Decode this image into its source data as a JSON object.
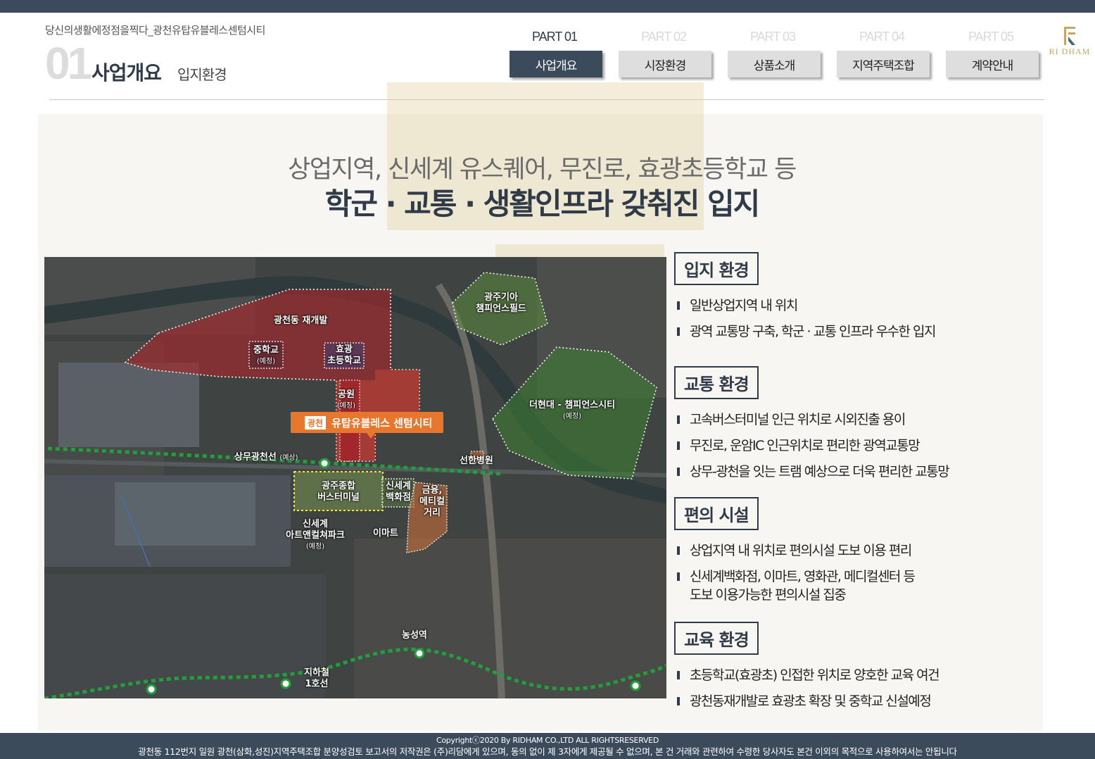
{
  "header": {
    "slogan": "당신의생활에정점을찍다_광천유탑유블레스센텀시티",
    "section_number": "01",
    "section_title": "사업개요",
    "section_subtitle": "입지환경"
  },
  "parts": [
    {
      "label": "PART 01",
      "button": "사업개요",
      "active": true
    },
    {
      "label": "PART 02",
      "button": "시장환경",
      "active": false
    },
    {
      "label": "PART 03",
      "button": "상품소개",
      "active": false
    },
    {
      "label": "PART 04",
      "button": "지역주택조합",
      "active": false
    },
    {
      "label": "PART 05",
      "button": "계약안내",
      "active": false
    }
  ],
  "logo": {
    "text": "RI DHAM",
    "color": "#c9a564"
  },
  "headline": {
    "line1": "상업지역, 신세계 유스퀘어, 무진로, 효광초등학교 등",
    "line2": "학군 · 교통 · 생활인프라 갖춰진 입지"
  },
  "map": {
    "labels": {
      "redevelopment": "광천동 재개발",
      "middle_school": "중학교",
      "middle_school_note": "(예정)",
      "elementary": "효광\n초등학교",
      "park": "공원",
      "park_note": "(예정)",
      "project_tag": "광천",
      "project_name": "유탑유블레스 센텀시티",
      "kia_field": "광주기아\n챔피언스필드",
      "hyundai_city": "더현대 - 챔피언스시티",
      "hyundai_city_note": "(예정)",
      "tram_line": "상무광천선",
      "tram_line_note": "(예상)",
      "hospital": "선한병원",
      "bus_terminal": "광주종합\n버스터미널",
      "shinsegae_dept": "신세계\n백화점",
      "finance_street": "금융,\n메티컬\n거리",
      "art_park": "신세계\n아트앤컬쳐파크",
      "art_park_note": "(예정)",
      "emart": "이마트",
      "nongseong_station": "농성역",
      "subway_line": "지하철\n1호선"
    }
  },
  "sections": [
    {
      "title": "입지 환경",
      "items": [
        "일반상업지역 내 위치",
        "광역 교통망 구축, 학군 · 교통 인프라 우수한 입지"
      ]
    },
    {
      "title": "교통 환경",
      "items": [
        "고속버스터미널 인근 위치로 시외진출 용이",
        "무진로, 운암IC 인근위치로 편리한 광역교통망",
        "상무-광천을 잇는 트램 예상으로 더욱 편리한 교통망"
      ]
    },
    {
      "title": "편의 시설",
      "items": [
        "상업지역 내 위치로 편의시설 도보 이용 편리",
        "신세계백화점, 이마트, 영화관, 메디컬센터 등\n도보 이용가능한 편의시설 집중"
      ]
    },
    {
      "title": "교육 환경",
      "items": [
        "초등학교(효광초) 인접한 위치로 양호한 교육 여건",
        "광천동재개발로 효광초 확장 및 중학교 신설예정"
      ]
    }
  ],
  "footer": {
    "copyright": "Copyrightⓒ2020 By RIDHAM CO.,LTD ALL RIGHTSRESERVED",
    "notice": "광천동 112번지 일원 광천(삼화,성진)지역주택조합 분양성검토 보고서의 저작권은 (주)리담에게 있으며, 동의 없이 제 3자에게 제공될 수 없으며, 본 건 거래와 관련하여 수령한 당사자도 본건 이외의 목적으로 사용하여서는 안됩니다"
  },
  "colors": {
    "navy": "#3b4b5c",
    "accent_orange": "#e8772e",
    "gold": "#c9a564"
  }
}
